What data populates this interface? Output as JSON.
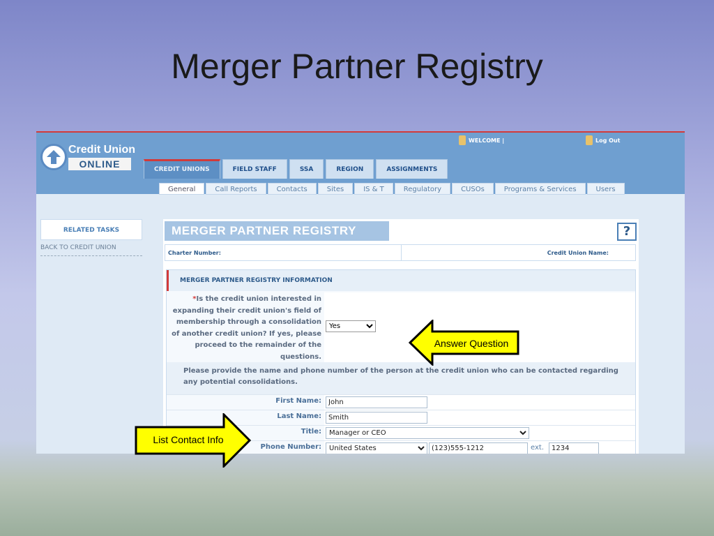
{
  "slide": {
    "title": "Merger Partner Registry"
  },
  "app": {
    "logo_line1": "Credit Union",
    "logo_line2": "ONLINE",
    "welcome": "WELCOME |",
    "logout": "Log Out",
    "main_tabs": [
      "CREDIT UNIONS",
      "FIELD STAFF",
      "SSA",
      "REGION",
      "ASSIGNMENTS"
    ],
    "sub_tabs": [
      "General",
      "Call Reports",
      "Contacts",
      "Sites",
      "IS & T",
      "Regulatory",
      "CUSOs",
      "Programs & Services",
      "Users"
    ]
  },
  "sidebar": {
    "heading": "RELATED TASKS",
    "back_link": "BACK TO CREDIT UNION"
  },
  "panel": {
    "title": "MERGER PARTNER REGISTRY",
    "help": "?",
    "charter_label": "Charter Number:",
    "cu_name_label": "Credit Union Name:",
    "section_title": "MERGER PARTNER REGISTRY INFORMATION",
    "question_required": "*",
    "question": "Is the credit union interested in expanding their credit union's field of membership through a consolidation of another credit union? If yes, please proceed to the remainder of the questions.",
    "answer": "Yes",
    "instruction": "Please provide the name and phone number of the person at the credit union who can be contacted regarding any potential consolidations.",
    "first_name_label": "First Name:",
    "first_name": "John",
    "last_name_label": "Last Name:",
    "last_name": "Smith",
    "title_label": "Title:",
    "title_value": "Manager or CEO",
    "phone_label": "Phone Number:",
    "country": "United States",
    "phone": "(123)555-1212",
    "ext_label": "ext.",
    "ext": "1234"
  },
  "callouts": {
    "answer": "Answer Question",
    "contact": "List Contact Info"
  },
  "colors": {
    "callout_fill": "#ffff00",
    "accent_red": "#d23a3a",
    "header_blue": "#6f9fd0"
  }
}
